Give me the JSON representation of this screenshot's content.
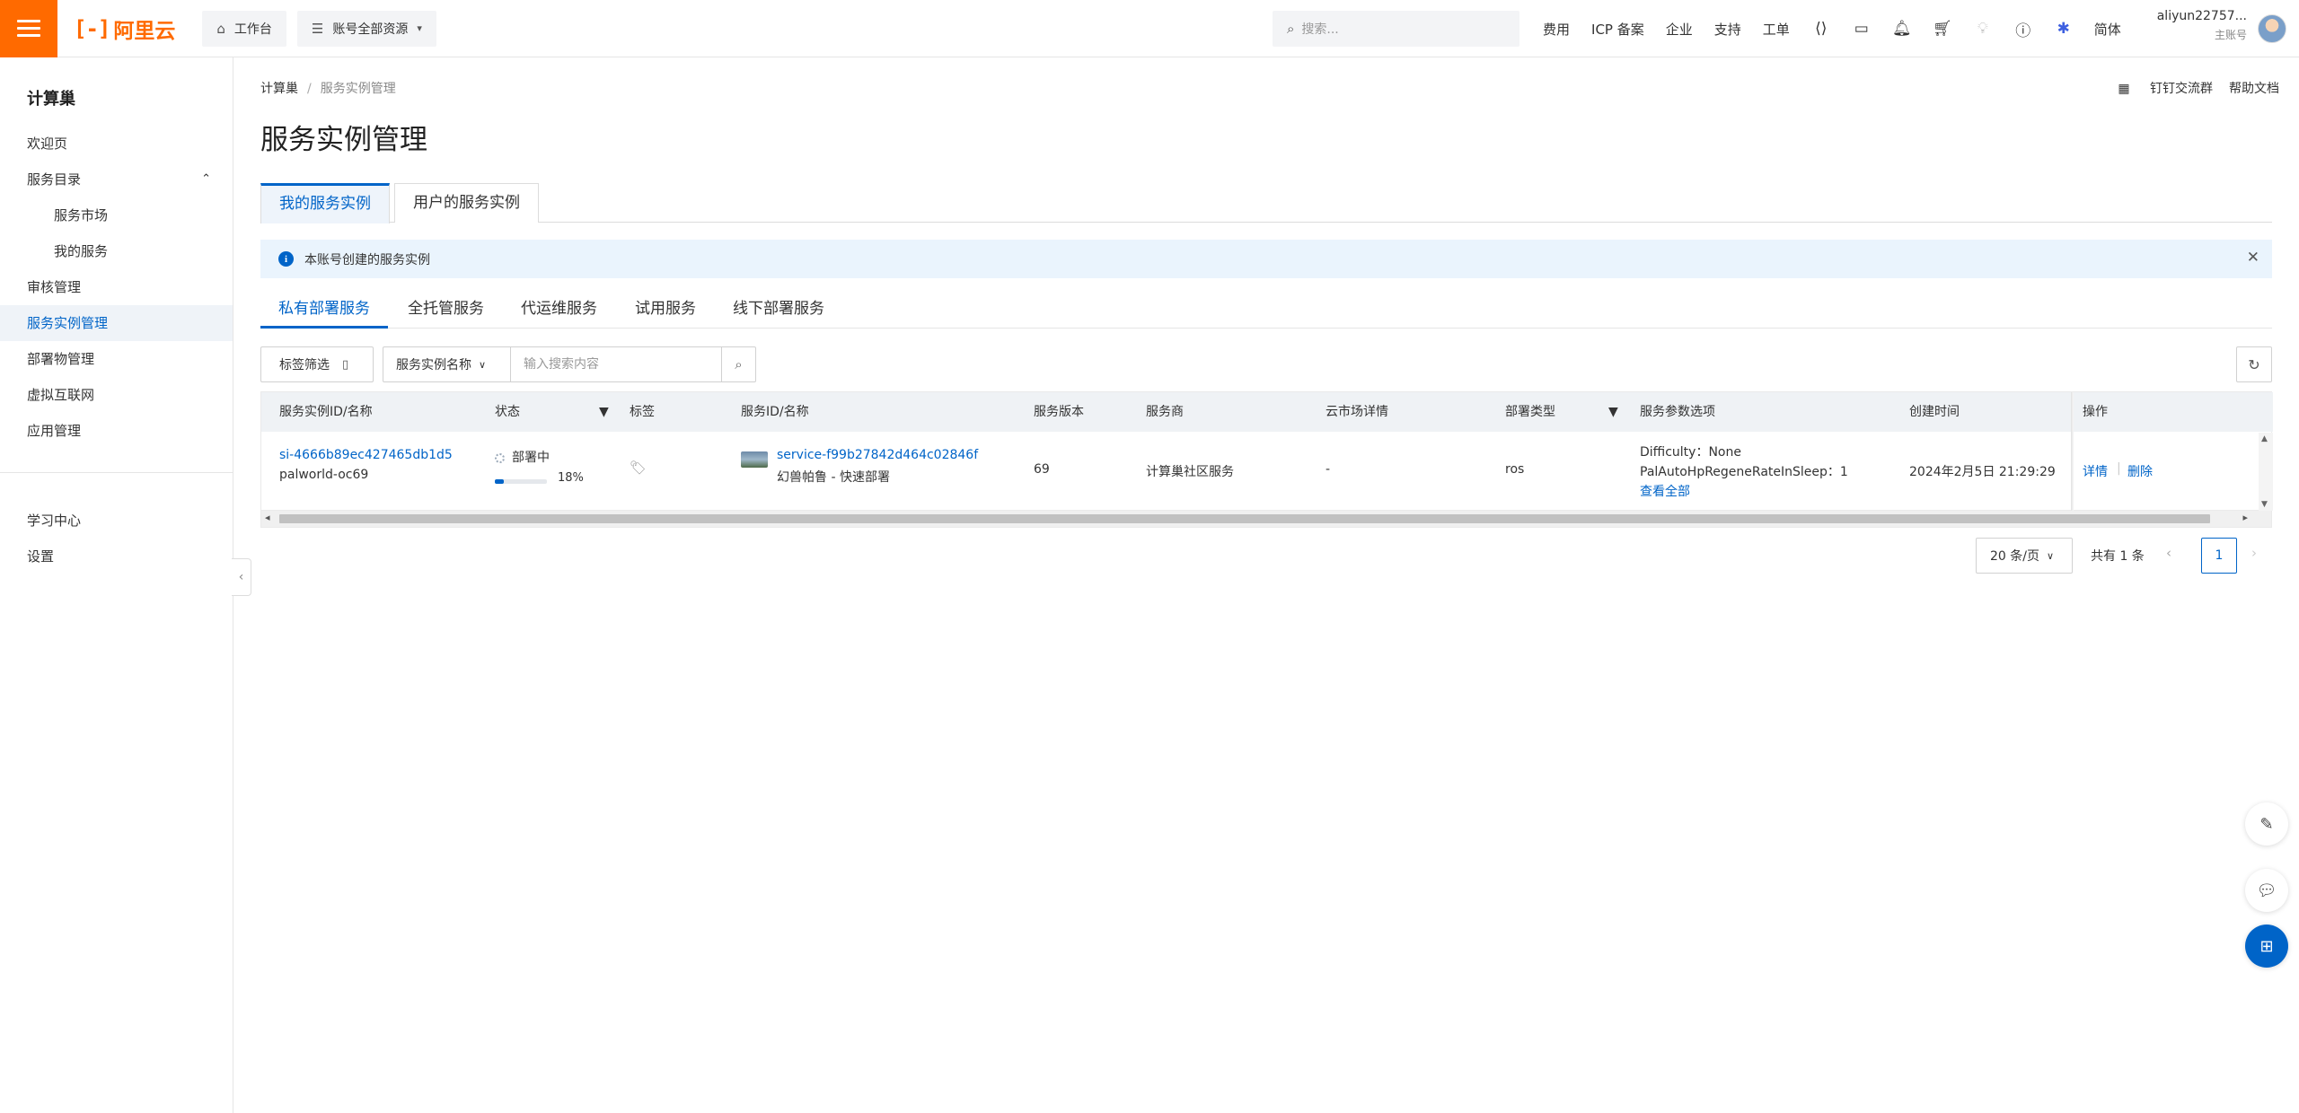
{
  "topbar": {
    "logo_text": "阿里云",
    "workbench": "工作台",
    "account_resources": "账号全部资源",
    "search_placeholder": "搜索...",
    "links": [
      "费用",
      "ICP 备案",
      "企业",
      "支持",
      "工单"
    ],
    "lang": "简体",
    "username": "aliyun22757...",
    "user_role": "主账号"
  },
  "sidebar": {
    "title": "计算巢",
    "items": [
      {
        "label": "欢迎页"
      },
      {
        "label": "服务目录"
      },
      {
        "label": "服务市场"
      },
      {
        "label": "我的服务"
      },
      {
        "label": "审核管理"
      },
      {
        "label": "服务实例管理"
      },
      {
        "label": "部署物管理"
      },
      {
        "label": "虚拟互联网"
      },
      {
        "label": "应用管理"
      }
    ],
    "bottom_items": [
      {
        "label": "学习中心"
      },
      {
        "label": "设置"
      }
    ]
  },
  "breadcrumb": [
    "计算巢",
    "服务实例管理"
  ],
  "header_links": {
    "dingtalk": "钉钉交流群",
    "help": "帮助文档"
  },
  "page_title": "服务实例管理",
  "outer_tabs": [
    "我的服务实例",
    "用户的服务实例"
  ],
  "notice": "本账号创建的服务实例",
  "inner_tabs": [
    "私有部署服务",
    "全托管服务",
    "代运维服务",
    "试用服务",
    "线下部署服务"
  ],
  "toolbar": {
    "tag_filter": "标签筛选",
    "search_field": "服务实例名称",
    "search_placeholder": "输入搜索内容"
  },
  "table": {
    "columns": [
      "服务实例ID/名称",
      "状态",
      "标签",
      "服务ID/名称",
      "服务版本",
      "服务商",
      "云市场详情",
      "部署类型",
      "服务参数选项",
      "创建时间",
      "操作"
    ],
    "rows": [
      {
        "instance_id": "si-4666b89ec427465db1d5",
        "instance_name": "palworld-oc69",
        "status": "部署中",
        "progress_percent": 18,
        "progress_label": "18%",
        "service_id": "service-f99b27842d464c02846f",
        "service_name": "幻兽帕鲁 - 快速部署",
        "version": "69",
        "provider": "计算巢社区服务",
        "market_detail": "-",
        "deploy_type": "ros",
        "param1": "Difficulty：None",
        "param2": "PalAutoHpRegeneRateInSleep：1",
        "view_all": "查看全部",
        "created": "2024年2月5日 21:29:29",
        "action_detail": "详情",
        "action_delete": "删除"
      }
    ]
  },
  "pagination": {
    "page_size": "20 条/页",
    "total": "共有 1 条",
    "current": "1"
  },
  "colors": {
    "brand": "#ff6a00",
    "primary": "#0064c8"
  }
}
